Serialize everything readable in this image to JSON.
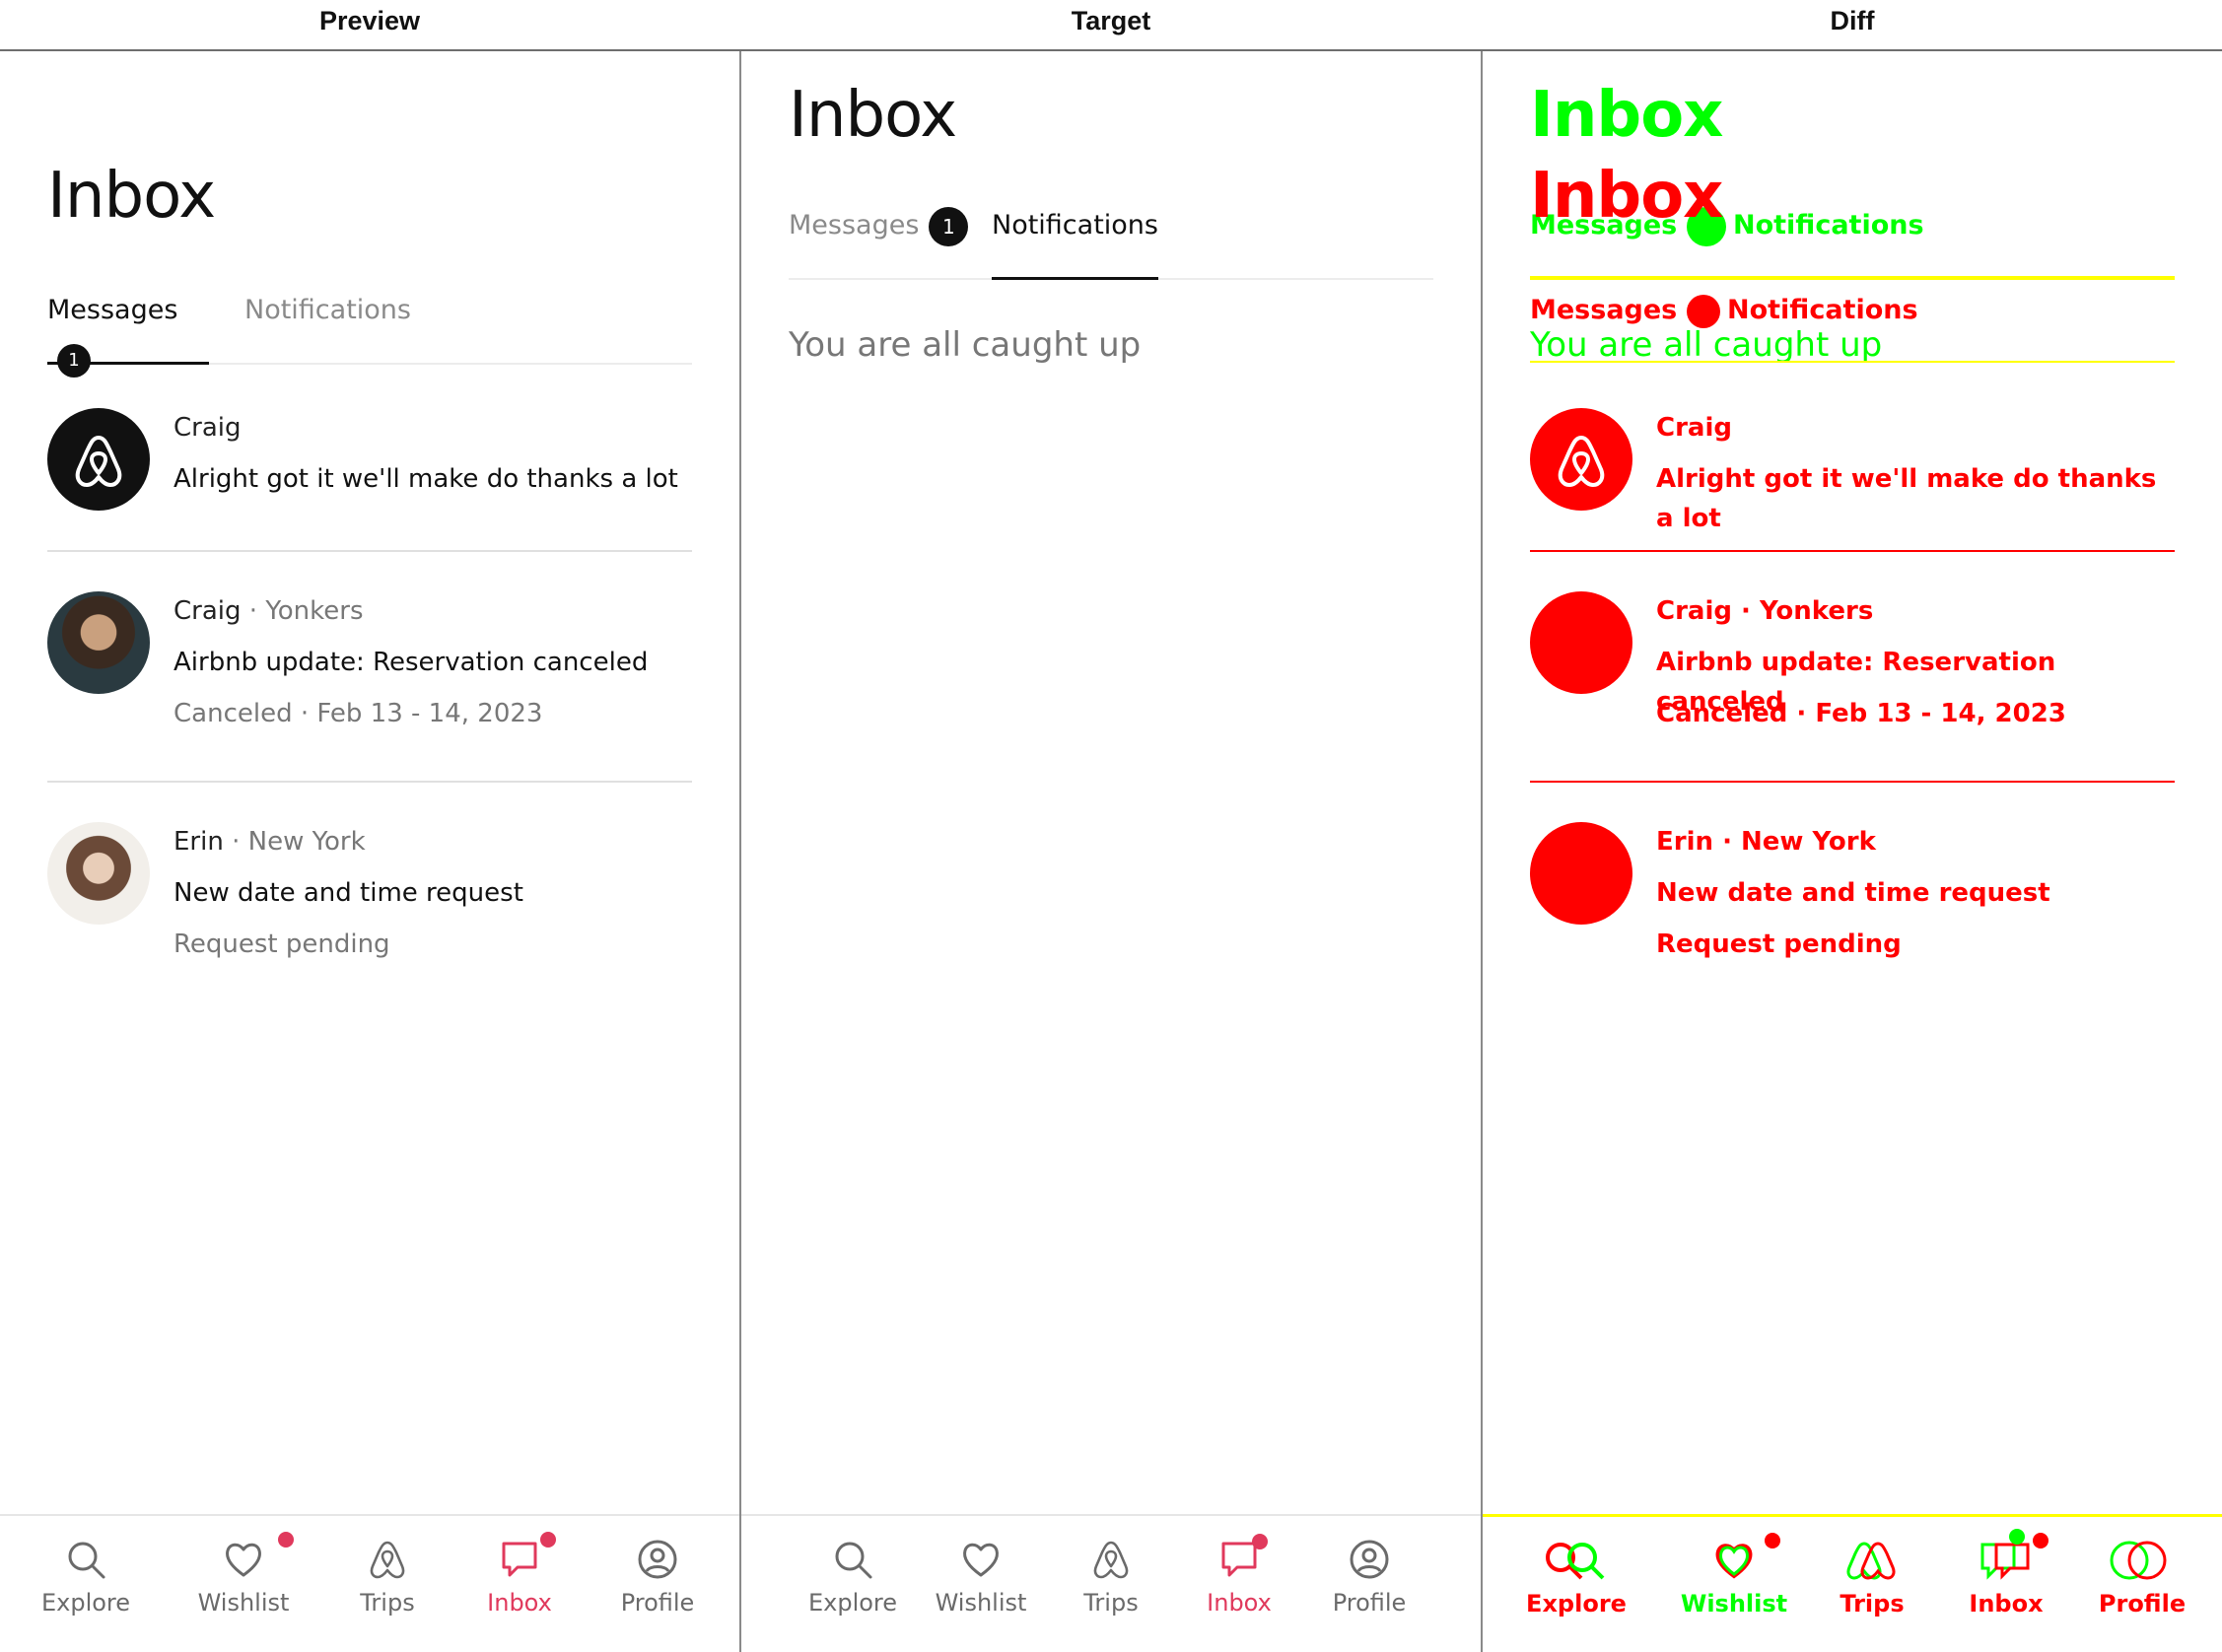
{
  "panels": {
    "preview": "Preview",
    "target": "Target",
    "diff": "Diff"
  },
  "app": {
    "title": "Inbox",
    "tabs": {
      "messages": "Messages",
      "notifications": "Notifications",
      "messages_badge": "1"
    },
    "empty_state": "You are all caught up",
    "messages": [
      {
        "sender": "Craig",
        "location": "",
        "body": "Alright got it we'll make do thanks a lot",
        "meta": ""
      },
      {
        "sender": "Craig",
        "location": "Yonkers",
        "body": "Airbnb update: Reservation canceled",
        "meta": "Canceled · Feb 13 - 14, 2023"
      },
      {
        "sender": "Erin",
        "location": "New York",
        "body": "New date and time request",
        "meta": "Request pending"
      }
    ],
    "separator": " · ",
    "nav": {
      "explore": "Explore",
      "wishlist": "Wishlist",
      "trips": "Trips",
      "inbox": "Inbox",
      "profile": "Profile"
    }
  },
  "colors": {
    "accent": "#e0395c",
    "text": "#222222",
    "muted": "#777777",
    "diff_added": "#00ff00",
    "diff_removed": "#ff0000"
  }
}
